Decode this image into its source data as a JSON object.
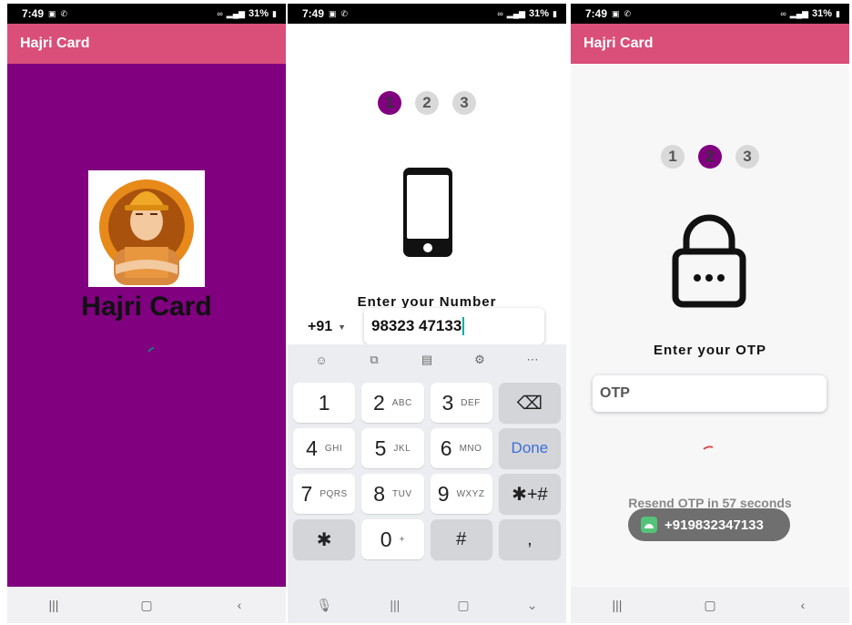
{
  "status_bar": {
    "time": "7:49",
    "battery": "31%"
  },
  "screens": {
    "splash": {
      "app_title": "Hajri Card",
      "brand_title": "Hajri Card",
      "background_color": "#800080"
    },
    "phone_entry": {
      "steps": [
        "1",
        "2",
        "3"
      ],
      "active_step": 1,
      "heading": "Enter your Number",
      "country_code": "+91",
      "phone_value": "98323 47133",
      "keyboard": {
        "toolbar_icons": [
          "emoji-icon",
          "sticker-icon",
          "clipboard-icon",
          "settings-icon",
          "more-icon"
        ],
        "keys": [
          {
            "num": "1",
            "letters": ""
          },
          {
            "num": "2",
            "letters": "ABC"
          },
          {
            "num": "3",
            "letters": "DEF"
          },
          {
            "num": "⌫",
            "letters": "",
            "kind": "backspace"
          },
          {
            "num": "4",
            "letters": "GHI"
          },
          {
            "num": "5",
            "letters": "JKL"
          },
          {
            "num": "6",
            "letters": "MNO"
          },
          {
            "num": "Done",
            "letters": "",
            "kind": "done"
          },
          {
            "num": "7",
            "letters": "PQRS"
          },
          {
            "num": "8",
            "letters": "TUV"
          },
          {
            "num": "9",
            "letters": "WXYZ"
          },
          {
            "num": "✱+#",
            "letters": "",
            "kind": "symbol"
          },
          {
            "num": "✱",
            "letters": "",
            "kind": "symbol"
          },
          {
            "num": "0",
            "letters": "+"
          },
          {
            "num": "#",
            "letters": "",
            "kind": "symbol"
          },
          {
            "num": ",",
            "letters": "",
            "kind": "symbol"
          }
        ]
      }
    },
    "otp_entry": {
      "app_title": "Hajri Card",
      "steps": [
        "1",
        "2",
        "3"
      ],
      "active_step": 2,
      "heading": "Enter your OTP",
      "otp_placeholder": "OTP",
      "resend_text": "Resend OTP in 57 seconds",
      "toast_text": "+919832347133"
    }
  },
  "colors": {
    "appbar": "#d94f7a",
    "accent": "#800080",
    "done_key": "#3b6fd8"
  }
}
